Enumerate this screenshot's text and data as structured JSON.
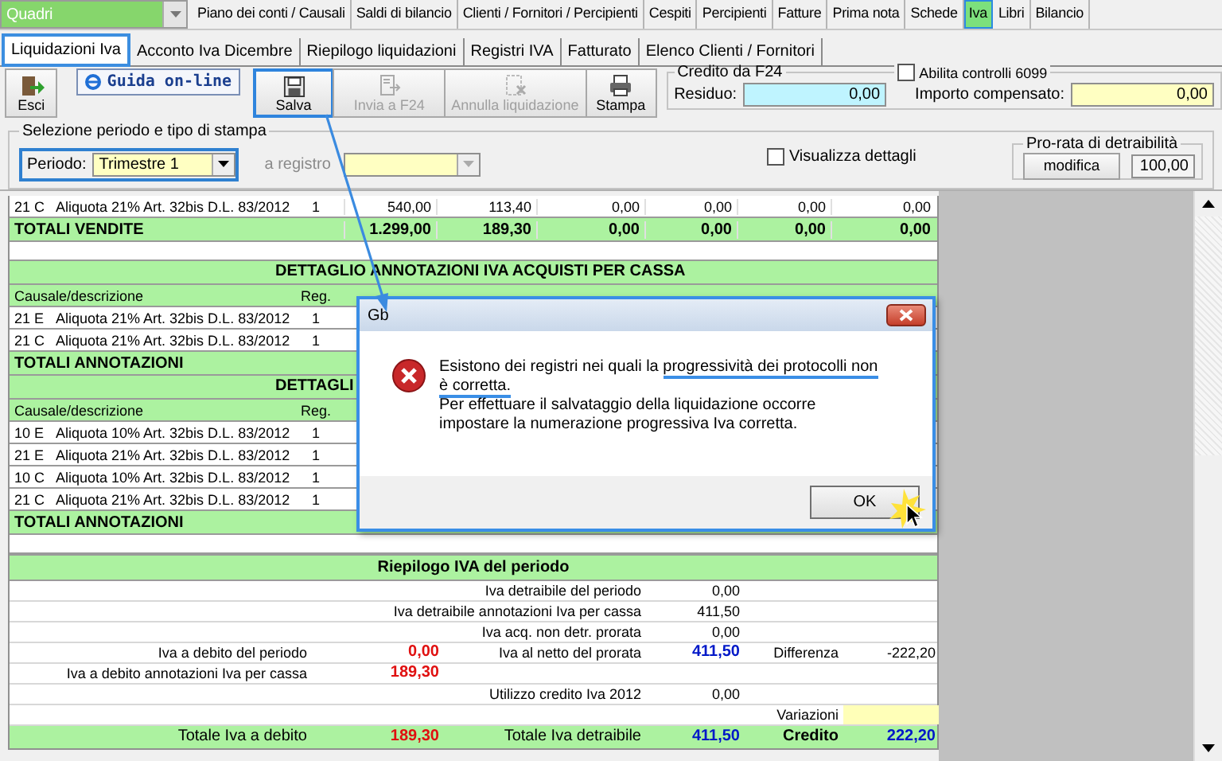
{
  "menu": {
    "combo": "Quadri",
    "items": [
      {
        "label": "Piano dei conti / Causali",
        "selected": false
      },
      {
        "label": "Saldi di bilancio",
        "selected": false
      },
      {
        "label": "Clienti / Fornitori / Percipienti",
        "selected": false
      },
      {
        "label": "Cespiti",
        "selected": false
      },
      {
        "label": "Percipienti",
        "selected": false
      },
      {
        "label": "Fatture",
        "selected": false
      },
      {
        "label": "Prima nota",
        "selected": false
      },
      {
        "label": "Schede",
        "selected": false
      },
      {
        "label": "Iva",
        "selected": true
      },
      {
        "label": "Libri",
        "selected": false
      },
      {
        "label": "Bilancio",
        "selected": false
      }
    ]
  },
  "tabs": [
    {
      "label": "Liquidazioni Iva",
      "selected": true
    },
    {
      "label": "Acconto Iva Dicembre",
      "selected": false
    },
    {
      "label": "Riepilogo liquidazioni",
      "selected": false
    },
    {
      "label": "Registri IVA",
      "selected": false
    },
    {
      "label": "Fatturato",
      "selected": false
    },
    {
      "label": "Elenco Clienti / Fornitori",
      "selected": false
    }
  ],
  "toolbar": {
    "help_link": "Guida on-line",
    "buttons": [
      {
        "kind": "exit",
        "label": "Esci",
        "disabled": false,
        "highlighted": false
      },
      {
        "kind": "save",
        "label": "Salva",
        "disabled": false,
        "highlighted": true
      },
      {
        "kind": "send",
        "label": "Invia a F24",
        "disabled": true,
        "highlighted": false
      },
      {
        "kind": "cancel",
        "label": "Annulla liquidazione",
        "disabled": true,
        "highlighted": false
      },
      {
        "kind": "print",
        "label": "Stampa",
        "disabled": false,
        "highlighted": false
      }
    ]
  },
  "credito_f24": {
    "title": "Credito da F24",
    "residuo_label": "Residuo:",
    "residuo": "0,00",
    "compensato_label": "Importo compensato:",
    "compensato": "0,00"
  },
  "controlli_6099": {
    "label": "Abilita controlli 6099",
    "checked": false
  },
  "selezione": {
    "title": "Selezione periodo e tipo di stampa",
    "periodo_label": "Periodo:",
    "periodo": "Trimestre 1",
    "registro_label": "a registro",
    "registro_disabled": true
  },
  "dettagli": {
    "label": "Visualizza dettagli",
    "checked": false
  },
  "prorata": {
    "title": "Pro-rata di detraibilità",
    "button": "modifica",
    "value": "100,00"
  },
  "grid": {
    "rows": [
      {
        "kind": "data",
        "code": "21 C",
        "description": "Aliquota 21% Art. 32bis D.L. 83/2012",
        "reg": "1",
        "values": [
          "540,00",
          "113,40",
          "0,00",
          "0,00",
          "0,00",
          "0,00"
        ]
      },
      {
        "kind": "total",
        "label": "TOTALI VENDITE",
        "values": [
          "1.299,00",
          "189,30",
          "0,00",
          "0,00",
          "0,00",
          "0,00"
        ]
      },
      {
        "kind": "blank"
      },
      {
        "kind": "heading",
        "title": "DETTAGLIO ANNOTAZIONI IVA ACQUISTI PER CASSA"
      },
      {
        "kind": "columns",
        "labels": [
          "Causale/descrizione",
          "Reg."
        ]
      },
      {
        "kind": "data",
        "code": "21 E",
        "description": "Aliquota 21% Art. 32bis D.L. 83/2012",
        "reg": "1"
      },
      {
        "kind": "data",
        "code": "21 C",
        "description": "Aliquota 21% Art. 32bis D.L. 83/2012",
        "reg": "1"
      },
      {
        "kind": "total",
        "label": "TOTALI ANNOTAZIONI"
      },
      {
        "kind": "heading",
        "title": "DETTAGLI"
      },
      {
        "kind": "columns",
        "labels": [
          "Causale/descrizione",
          "Reg."
        ]
      },
      {
        "kind": "data",
        "code": "10 E",
        "description": "Aliquota 10% Art. 32bis D.L. 83/2012",
        "reg": "1"
      },
      {
        "kind": "data",
        "code": "21 E",
        "description": "Aliquota 21% Art. 32bis D.L. 83/2012",
        "reg": "1"
      },
      {
        "kind": "data",
        "code": "10 C",
        "description": "Aliquota 10% Art. 32bis D.L. 83/2012",
        "reg": "1"
      },
      {
        "kind": "data",
        "code": "21 C",
        "description": "Aliquota 21% Art. 32bis D.L. 83/2012",
        "reg": "1"
      },
      {
        "kind": "total",
        "label": "TOTALI ANNOTAZIONI"
      },
      {
        "kind": "blank"
      }
    ]
  },
  "summary": {
    "title": "Riepilogo IVA del periodo",
    "rows": [
      {
        "kind": "normal",
        "mid_label": "Iva detraibile del periodo",
        "mid_value": {
          "text": "0,00",
          "color": "#000000",
          "bold": false
        }
      },
      {
        "kind": "normal",
        "mid_label": "Iva detraibile annotazioni Iva per cassa",
        "mid_value": {
          "text": "411,50",
          "color": "#000000",
          "bold": false
        }
      },
      {
        "kind": "normal",
        "mid_label": "Iva acq. non detr. prorata",
        "mid_value": {
          "text": "0,00",
          "color": "#000000",
          "bold": false
        }
      },
      {
        "kind": "normal",
        "left_label": "Iva a debito del periodo",
        "left_value": {
          "text": "0,00",
          "color": "#e01010",
          "bold": true
        },
        "mid_label": "Iva al netto del prorata",
        "mid_value": {
          "text": "411,50",
          "color": "#0018c8",
          "bold": true
        },
        "right_label": "Differenza",
        "right_value": {
          "text": "-222,20",
          "color": "#000000",
          "bold": false
        }
      },
      {
        "kind": "normal",
        "left_label": "Iva a debito annotazioni Iva per cassa",
        "left_value": {
          "text": "189,30",
          "color": "#e01010",
          "bold": true
        }
      },
      {
        "kind": "normal",
        "mid_label": "Utilizzo credito Iva 2012",
        "mid_value": {
          "text": "0,00",
          "color": "#000000",
          "bold": false
        }
      },
      {
        "kind": "input",
        "right_label": "Variazioni"
      },
      {
        "kind": "total",
        "left_label": "Totale Iva a debito",
        "left_value": {
          "text": "189,30",
          "color": "#e01010",
          "bold": true
        },
        "mid_label": "Totale Iva detraibile",
        "mid_value": {
          "text": "411,50",
          "color": "#0018c8",
          "bold": true
        },
        "right_label": "Credito",
        "right_value": {
          "text": "222,20",
          "color": "#0018c8",
          "bold": true
        }
      }
    ]
  },
  "dialog": {
    "title": "Gb",
    "message": [
      {
        "text": "Esistono dei registri nei quali la ",
        "underlined": false
      },
      {
        "text": "progressività dei protocolli non è corretta.",
        "underlined": true
      }
    ],
    "detail": "Per effettuare il salvataggio della liquidazione occorre impostare la numerazione progressiva Iva corretta.",
    "button": "OK"
  }
}
